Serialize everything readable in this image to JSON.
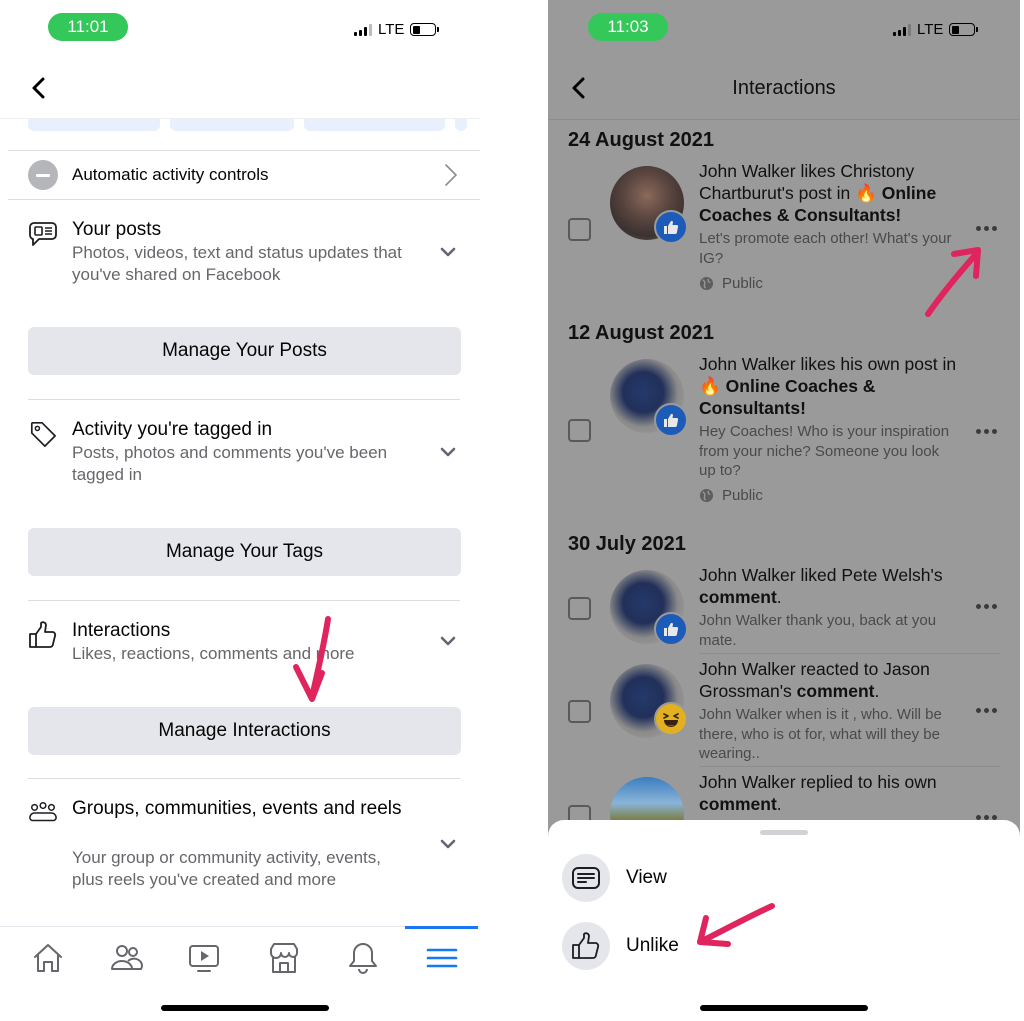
{
  "left_screen": {
    "status_bar": {
      "time": "11:01",
      "network": "LTE",
      "battery_fraction": 0.35
    },
    "automatic_activity": {
      "label": "Automatic activity controls"
    },
    "sections": [
      {
        "id": "your-posts",
        "icon": "post-bubble-icon",
        "title": "Your posts",
        "description": "Photos, videos, text and status updates that you've shared on Facebook",
        "button": "Manage Your Posts"
      },
      {
        "id": "tagged",
        "icon": "tag-icon",
        "title": "Activity you're tagged in",
        "description": "Posts, photos and comments you've been tagged in",
        "button": "Manage Your Tags"
      },
      {
        "id": "interactions",
        "icon": "thumbs-up-icon",
        "title": "Interactions",
        "description": "Likes, reactions, comments and more",
        "button": "Manage Interactions"
      },
      {
        "id": "groups",
        "icon": "people-group-icon",
        "title": "Groups, communities, events and reels",
        "description": "Your group or community activity, events, plus reels you've created and more"
      }
    ],
    "tab_bar": {
      "tabs": [
        {
          "name": "home",
          "icon": "home-icon"
        },
        {
          "name": "friends",
          "icon": "friends-icon"
        },
        {
          "name": "watch",
          "icon": "video-play-icon"
        },
        {
          "name": "marketplace",
          "icon": "storefront-icon"
        },
        {
          "name": "notifications",
          "icon": "bell-icon"
        },
        {
          "name": "menu",
          "icon": "hamburger-menu-icon",
          "active": true
        }
      ],
      "active_color": "#1877f2"
    }
  },
  "right_screen": {
    "status_bar": {
      "time": "11:03",
      "network": "LTE",
      "battery_fraction": 0.35
    },
    "header": {
      "title": "Interactions"
    },
    "groups": [
      {
        "date": "24 August 2021",
        "items": [
          {
            "text_plain": "John Walker likes Christony Chartburut's post in ",
            "text_emoji": "🔥",
            "text_bold": "Online Coaches & Consultants!",
            "snippet": "Let's promote each other! What's your IG?",
            "privacy": "Public",
            "reaction": "like"
          }
        ]
      },
      {
        "date": "12 August 2021",
        "items": [
          {
            "text_plain": "John Walker likes his own post in ",
            "text_emoji": "🔥",
            "text_bold": "Online Coaches & Consultants!",
            "snippet": "Hey Coaches! Who is your inspiration from your niche? Someone you look up to?",
            "privacy": "Public",
            "reaction": "like"
          }
        ]
      },
      {
        "date": "30 July 2021",
        "items": [
          {
            "text_plain": "John Walker liked Pete Welsh's ",
            "text_bold": "comment",
            "text_tail": ".",
            "snippet": "John Walker thank you, back at you mate.",
            "reaction": "like"
          },
          {
            "text_plain": "John Walker reacted to Jason Grossman's ",
            "text_bold": "comment",
            "text_tail": ".",
            "snippet": "John Walker when is it , who. Will be there, who is ot for, what will they be wearing..",
            "reaction": "haha"
          },
          {
            "text_plain": "John Walker replied to his own ",
            "text_bold": "comment",
            "text_tail": "."
          }
        ]
      }
    ],
    "action_sheet": {
      "options": [
        {
          "label": "View",
          "icon": "document-lines-icon"
        },
        {
          "label": "Unlike",
          "icon": "thumbs-up-icon"
        }
      ]
    }
  },
  "annotations": {
    "arrow_color": "#e0245e"
  }
}
